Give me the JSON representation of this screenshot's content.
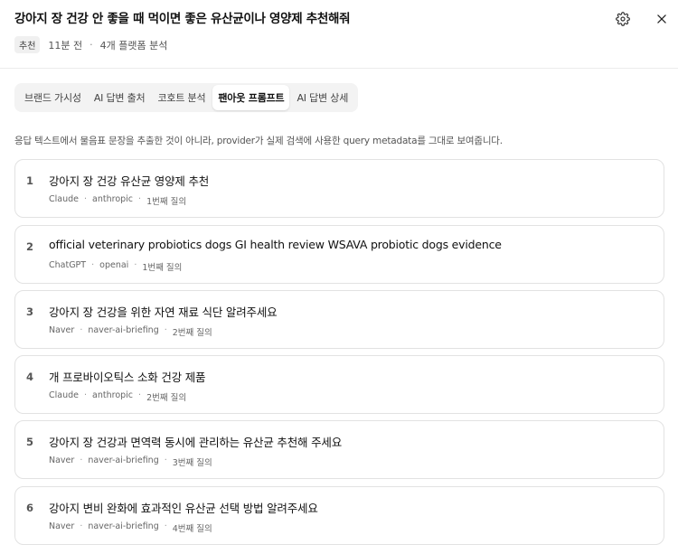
{
  "header": {
    "title": "강아지 장 건강 안 좋을 때 먹이면 좋은 유산균이나 영양제 추천해줘",
    "badge": "추천",
    "time": "11분 전",
    "separator": "·",
    "platforms": "4개 플랫폼 분석",
    "icons": [
      "gear-icon",
      "close-icon"
    ]
  },
  "tabs": [
    {
      "label": "브랜드 가시성",
      "active": false
    },
    {
      "label": "AI 답변 출처",
      "active": false
    },
    {
      "label": "코호트 분석",
      "active": false
    },
    {
      "label": "팬아웃 프롬프트",
      "active": true
    },
    {
      "label": "AI 답변 상세",
      "active": false
    }
  ],
  "description": "응답 텍스트에서 물음표 문장을 추출한 것이 아니라, provider가 실제 검색에 사용한 query metadata를 그대로 보여줍니다.",
  "queries": [
    {
      "num": "1",
      "text": "강아지 장 건강 유산균 영양제 추천",
      "model": "Claude",
      "provider": "anthropic",
      "round": "1번째 질의"
    },
    {
      "num": "2",
      "text": "official veterinary probiotics dogs GI health review WSAVA probiotic dogs evidence",
      "model": "ChatGPT",
      "provider": "openai",
      "round": "1번째 질의"
    },
    {
      "num": "3",
      "text": "강아지 장 건강을 위한 자연 재료 식단 알려주세요",
      "model": "Naver",
      "provider": "naver-ai-briefing",
      "round": "2번째 질의"
    },
    {
      "num": "4",
      "text": "개 프로바이오틱스 소화 건강 제품",
      "model": "Claude",
      "provider": "anthropic",
      "round": "2번째 질의"
    },
    {
      "num": "5",
      "text": "강아지 장 건강과 면역력 동시에 관리하는 유산균 추천해 주세요",
      "model": "Naver",
      "provider": "naver-ai-briefing",
      "round": "3번째 질의"
    },
    {
      "num": "6",
      "text": "강아지 변비 완화에 효과적인 유산균 선택 방법 알려주세요",
      "model": "Naver",
      "provider": "naver-ai-briefing",
      "round": "4번째 질의"
    }
  ]
}
